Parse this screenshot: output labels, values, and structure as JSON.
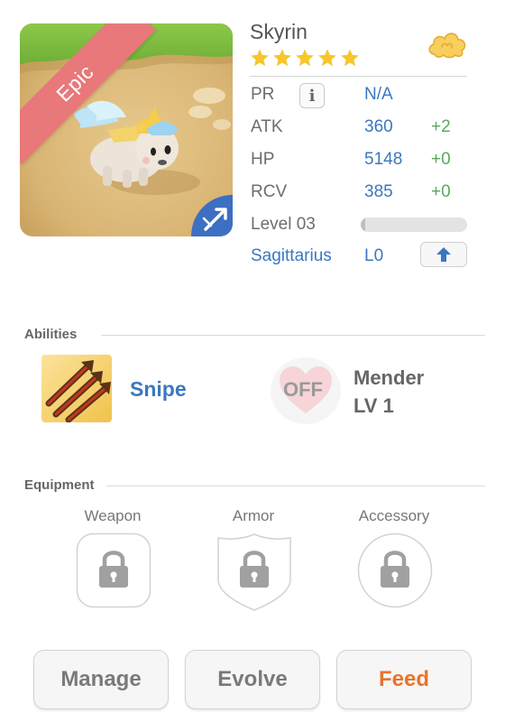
{
  "monster": {
    "name": "Skyrin",
    "rarity": "Epic",
    "stars": 5,
    "element_icon": "cloud-icon",
    "class_icon": "arrow-icon"
  },
  "stats": {
    "pr": {
      "label": "PR",
      "value": "N/A",
      "info_label": "i"
    },
    "atk": {
      "label": "ATK",
      "value": "360",
      "bonus": "+2"
    },
    "hp": {
      "label": "HP",
      "value": "5148",
      "bonus": "+0"
    },
    "rcv": {
      "label": "RCV",
      "value": "385",
      "bonus": "+0"
    },
    "level": {
      "label": "Level 03",
      "progress": 0.04
    },
    "sign": {
      "label": "Sagittarius",
      "value": "L0"
    }
  },
  "abilities": {
    "title": "Abilities",
    "primary": {
      "name": "Snipe"
    },
    "secondary": {
      "state": "OFF",
      "name": "Mender",
      "level": "LV 1"
    }
  },
  "equipment": {
    "title": "Equipment",
    "slots": [
      {
        "label": "Weapon"
      },
      {
        "label": "Armor"
      },
      {
        "label": "Accessory"
      }
    ]
  },
  "actions": {
    "manage": "Manage",
    "evolve": "Evolve",
    "feed": "Feed"
  },
  "colors": {
    "accent_blue": "#3a78c0",
    "bonus_green": "#5aa85a",
    "feed_orange": "#e8742a",
    "epic_ribbon": "#e8787a",
    "star_yellow": "#f6c62a"
  }
}
